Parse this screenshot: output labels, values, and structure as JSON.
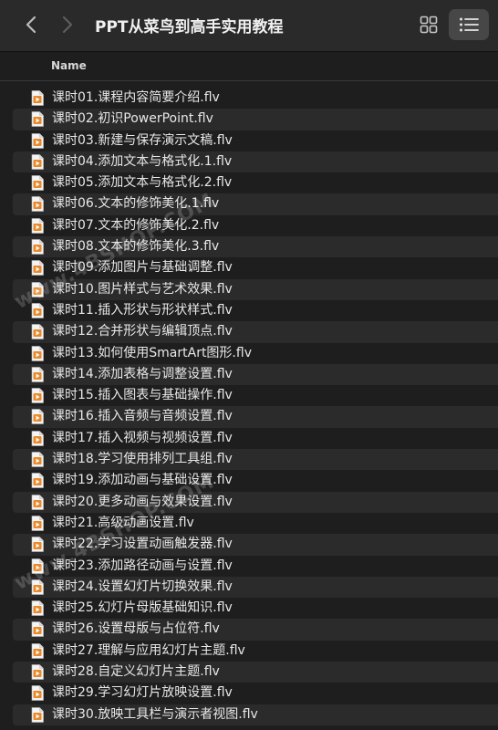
{
  "toolbar": {
    "title": "PPT从菜鸟到高手实用教程",
    "back_icon": "chevron-left-icon",
    "forward_icon": "chevron-right-icon",
    "grid_view_icon": "grid-view-icon",
    "list_view_icon": "list-view-icon"
  },
  "columns": {
    "name_label": "Name"
  },
  "files": [
    "课时01.课程内容简要介绍.flv",
    "课时02.初识PowerPoint.flv",
    "课时03.新建与保存演示文稿.flv",
    "课时04.添加文本与格式化.1.flv",
    "课时05.添加文本与格式化.2.flv",
    "课时06.文本的修饰美化.1.flv",
    "课时07.文本的修饰美化.2.flv",
    "课时08.文本的修饰美化.3.flv",
    "课时09.添加图片与基础调整.flv",
    "课时10.图片样式与艺术效果.flv",
    "课时11.插入形状与形状样式.flv",
    "课时12.合并形状与编辑顶点.flv",
    "课时13.如何使用SmartArt图形.flv",
    "课时14.添加表格与调整设置.flv",
    "课时15.插入图表与基础操作.flv",
    "课时16.插入音频与音频设置.flv",
    "课时17.插入视频与视频设置.flv",
    "课时18.学习使用排列工具组.flv",
    "课时19.添加动画与基础设置.flv",
    "课时20.更多动画与效果设置.flv",
    "课时21.高级动画设置.flv",
    "课时22.学习设置动画触发器.flv",
    "课时23.添加路径动画与设置.flv",
    "课时24.设置幻灯片切换效果.flv",
    "课时25.幻灯片母版基础知识.flv",
    "课时26.设置母版与占位符.flv",
    "课时27.理解与应用幻灯片主题.flv",
    "课时28.自定义幻灯片主题.flv",
    "课时29.学习幻灯片放映设置.flv",
    "课时30.放映工具栏与演示者视图.flv"
  ],
  "file_icon": "flv-video-file-icon",
  "watermarks": [
    "www.4BSHOP.COM",
    "www.4BSHOP.COM"
  ],
  "colors": {
    "background": "#1e1e1e",
    "toolbar": "#2a2a2a",
    "alt_row": "#2b2b2b",
    "file_icon_orange": "#e8892b"
  }
}
